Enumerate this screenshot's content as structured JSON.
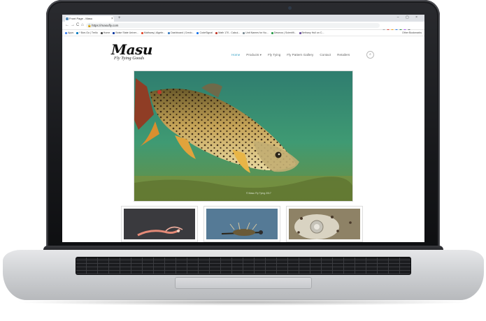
{
  "browser": {
    "tab_title": "Front Page - Masu",
    "tab_close": "×",
    "new_tab": "+",
    "window_controls": "– ▢ ×",
    "nav_back": "←",
    "nav_forward": "→",
    "nav_reload": "C",
    "nav_home": "⌂",
    "url": "https://masufly.com",
    "lock_icon": "🔒",
    "bookmarks": [
      {
        "label": "Apps",
        "color": "#4285f4"
      },
      {
        "label": "* Boe-Go | Trello",
        "color": "#0079bf"
      },
      {
        "label": "Home",
        "color": "#444444"
      },
      {
        "label": "Boise State Univer...",
        "color": "#0033a0"
      },
      {
        "label": "Mathway | Algebr...",
        "color": "#e2492d"
      },
      {
        "label": "Dashboard | Credo...",
        "color": "#3c7dbf"
      },
      {
        "label": "CodeSignal",
        "color": "#1a73e8"
      },
      {
        "label": "Math 170 - Calcul...",
        "color": "#c0392b"
      },
      {
        "label": "Unit Names for Nu...",
        "color": "#7b8b93"
      },
      {
        "label": "Desmos | Scientifi...",
        "color": "#2b9c4a"
      },
      {
        "label": "Bethany Hull on C...",
        "color": "#6b4f9e"
      }
    ],
    "other_bookmarks": "Other Bookmarks",
    "extension_colors": [
      "#9aa0a6",
      "#d93025",
      "#f29900",
      "#1a73e8",
      "#188038",
      "#a142f4",
      "#5f6368"
    ]
  },
  "site": {
    "logo_name": "Masu",
    "logo_tagline": "Fly Tying Goods",
    "nav": [
      "Home",
      "Products ▾",
      "Fly Tying",
      "Fly Pattern Gallery",
      "Contact",
      "Retailers"
    ],
    "active_nav": "Home",
    "search_icon": "⌕",
    "accent_color": "#3aa3c6",
    "hero_caption": "© Masu Fly Tying 2017"
  }
}
